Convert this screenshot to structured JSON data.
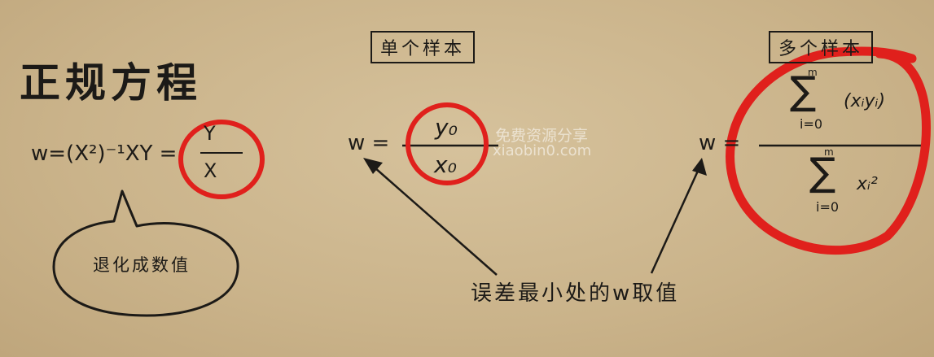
{
  "title": "正规方程",
  "labels": {
    "single": "单个样本",
    "multi": "多个样本"
  },
  "eq_left": "w=(X²)⁻¹XY =",
  "frac_left": {
    "num": "Y",
    "den": "X"
  },
  "eq_mid": {
    "w": "w =",
    "num": "y₀",
    "den": "x₀"
  },
  "eq_right": {
    "w": "w =",
    "num_upper": "m",
    "num_sigma": "∑",
    "num_lower": "i=0",
    "num_term": "(xᵢyᵢ)",
    "den_upper": "m",
    "den_sigma": "∑",
    "den_lower": "i=0",
    "den_term": "xᵢ²"
  },
  "bubble": "退化成数值",
  "caption": "误差最小处的w取值",
  "watermark": {
    "line1": "免费资源分享",
    "line2": "xiaobin0.com"
  },
  "colors": {
    "ink": "#1c1a17",
    "circle": "#e0201c",
    "paper": "#cdb78e"
  }
}
